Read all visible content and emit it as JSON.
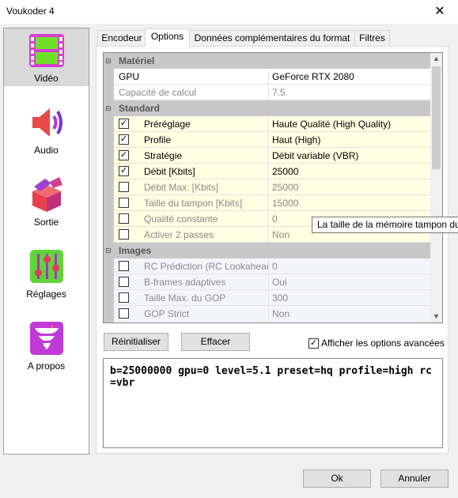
{
  "window": {
    "title": "Voukoder 4",
    "close_glyph": "✕"
  },
  "sidebar": {
    "items": [
      {
        "label": "Vidéo",
        "icon": "video-film-icon"
      },
      {
        "label": "Audio",
        "icon": "speaker-icon"
      },
      {
        "label": "Sortie",
        "icon": "output-box-icon"
      },
      {
        "label": "Réglages",
        "icon": "sliders-icon"
      },
      {
        "label": "A propos",
        "icon": "about-tornado-icon"
      }
    ]
  },
  "tabs": [
    {
      "label": "Encodeur"
    },
    {
      "label": "Options"
    },
    {
      "label": "Données complémentaires du format"
    },
    {
      "label": "Filtres"
    }
  ],
  "grid": {
    "scroll_up": "▲",
    "scroll_down": "▼",
    "rows": [
      {
        "type": "category",
        "expander": "⊟",
        "name": "Matériel"
      },
      {
        "type": "prop",
        "name": "GPU",
        "value": "GeForce RTX 2080"
      },
      {
        "type": "prop",
        "name": "Capacité de calcul",
        "value": "7.5"
      },
      {
        "type": "category",
        "expander": "⊟",
        "name": "Standard"
      },
      {
        "type": "check",
        "checked": true,
        "mark": "✓",
        "name": "Préréglage",
        "value": "Haute Qualité (High Quality)"
      },
      {
        "type": "check",
        "checked": true,
        "mark": "✓",
        "name": "Profile",
        "value": "Haut (High)"
      },
      {
        "type": "check",
        "checked": true,
        "mark": "✓",
        "name": "Stratégie",
        "value": "Débit variable (VBR)"
      },
      {
        "type": "check",
        "checked": true,
        "mark": "✓",
        "name": "Débit [Kbits]",
        "value": "25000"
      },
      {
        "type": "check",
        "checked": false,
        "mark": "",
        "name": "Débit Max. [Kbits]",
        "value": "25000"
      },
      {
        "type": "check",
        "checked": false,
        "mark": "",
        "name": "Taille du tampon [Kbits]",
        "value": "15000"
      },
      {
        "type": "check",
        "checked": false,
        "mark": "",
        "name": "Qualité constante",
        "value": "0"
      },
      {
        "type": "check",
        "checked": false,
        "mark": "",
        "name": "Activer 2 passes",
        "value": "Non"
      },
      {
        "type": "category",
        "expander": "⊟",
        "name": "Images"
      },
      {
        "type": "check",
        "checked": false,
        "mark": "",
        "name": "RC Prédiction (RC Lookahead)",
        "value": "0"
      },
      {
        "type": "check",
        "checked": false,
        "mark": "",
        "name": "B-frames adaptives",
        "value": "Oui"
      },
      {
        "type": "check",
        "checked": false,
        "mark": "",
        "name": "Taille Max. du GOP",
        "value": "300"
      },
      {
        "type": "check",
        "checked": false,
        "mark": "",
        "name": "GOP Strict",
        "value": "Non"
      }
    ]
  },
  "tooltip": "La taille de la mémoire tampon du",
  "buttons": {
    "reset": "Réinitialiser",
    "clear": "Effacer",
    "ok": "Ok",
    "cancel": "Annuler"
  },
  "advanced": {
    "label": "Afficher les options avancées",
    "checked": true,
    "mark": "✓"
  },
  "command_line": "b=25000000 gpu=0 level=5.1 preset=hq profile=high rc=vbr"
}
